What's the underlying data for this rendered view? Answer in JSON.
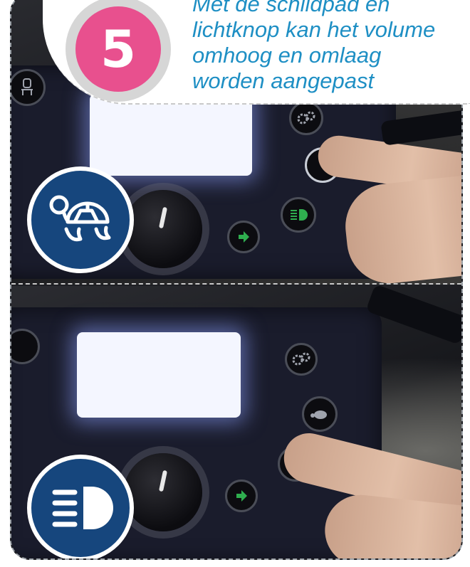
{
  "step": {
    "number": "5"
  },
  "instruction": {
    "line1": "Met de schildpad en",
    "line2": "lichtknop kan het volume",
    "line3": "omhoog en omlaag",
    "line4": "worden aangepast"
  },
  "icons": {
    "top_badge": "turtle-icon",
    "bottom_badge": "headlight-icon"
  },
  "colors": {
    "step_circle": "#e8508e",
    "step_ring": "#d6d6d6",
    "instruction_text": "#1e8fc4",
    "badge_background": "#16467d"
  }
}
